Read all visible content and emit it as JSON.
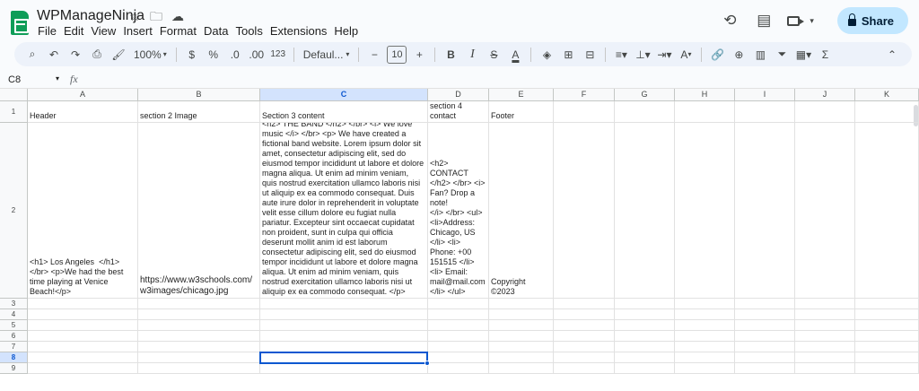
{
  "app": {
    "title": "WPManageNinja",
    "menu": [
      "File",
      "Edit",
      "View",
      "Insert",
      "Format",
      "Data",
      "Tools",
      "Extensions",
      "Help"
    ],
    "share_label": "Share"
  },
  "toolbar": {
    "zoom": "100%",
    "currency": "$",
    "percent": "%",
    "decrease_decimal": ".0",
    "increase_decimal": ".00",
    "number_format": "123",
    "font": "Defaul...",
    "font_size": "10",
    "bold": "B",
    "italic": "I",
    "strike": "S",
    "text_color": "A",
    "text_color_2": "A",
    "sum": "Σ"
  },
  "formula": {
    "name_box": "C8",
    "fx": "fx"
  },
  "sheet": {
    "columns": [
      "A",
      "B",
      "C",
      "D",
      "E",
      "F",
      "G",
      "H",
      "I",
      "J",
      "K"
    ],
    "rows": [
      "1",
      "2",
      "3",
      "4",
      "5",
      "6",
      "7",
      "8",
      "9"
    ],
    "selected_column": "C",
    "selected_row": "8",
    "cells": {
      "A1": "Header",
      "B1": "section 2 Image",
      "C1": "Section 3 content",
      "D1": "section 4\ncontact",
      "E1": "Footer",
      "A2": "<h1> Los Angeles  </h1> </br> <p>We had the best time playing at Venice Beach!</p>",
      "B2": "https://www.w3schools.com/w3images/chicago.jpg",
      "C2": "<h2> THE BAND </h2> </br> <i> We love music </i> </br> <p> We have created a fictional band website. Lorem ipsum dolor sit amet, consectetur adipiscing elit, sed do eiusmod tempor incididunt ut labore et dolore magna aliqua. Ut enim ad minim veniam, quis nostrud exercitation ullamco laboris nisi ut aliquip ex ea commodo consequat. Duis aute irure dolor in reprehenderit in voluptate velit esse cillum dolore eu fugiat nulla pariatur. Excepteur sint occaecat cupidatat non proident, sunt in culpa qui officia deserunt mollit anim id est laborum consectetur adipiscing elit, sed do eiusmod tempor incididunt ut labore et dolore magna aliqua. Ut enim ad minim veniam, quis nostrud exercitation ullamco laboris nisi ut aliquip ex ea commodo consequat. </p>",
      "D2": "<h2>\nCONTACT\n</h2> </br> <i>\nFan? Drop a\nnote!\n</i> </br> <ul>\n<li>Address:\nChicago, US\n</li> <li>\nPhone: +00\n151515 </li>\n<li> Email:\nmail@mail.com\n</li> </ul>",
      "E2": "Copyright ©2023"
    }
  }
}
